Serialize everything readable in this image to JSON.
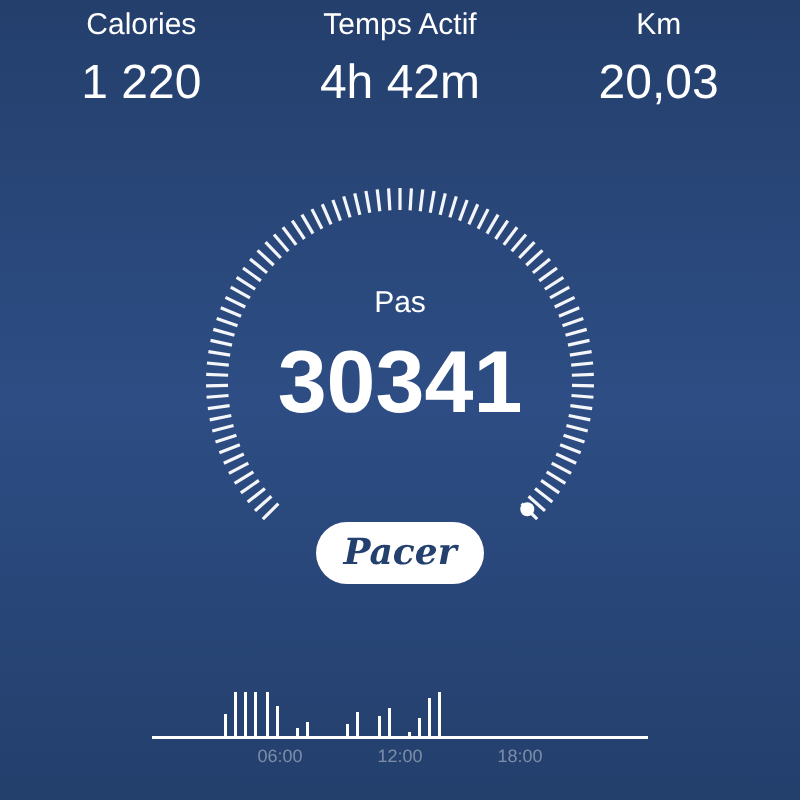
{
  "stats": [
    {
      "label": "Calories",
      "value": "1 220"
    },
    {
      "label": "Temps Actif",
      "value": "4h 42m"
    },
    {
      "label": "Km",
      "value": "20,03"
    }
  ],
  "gauge": {
    "label": "Pas",
    "value": "30341"
  },
  "logo": "Pacer",
  "timeline": {
    "labels": [
      "06:00",
      "12:00",
      "18:00"
    ]
  }
}
